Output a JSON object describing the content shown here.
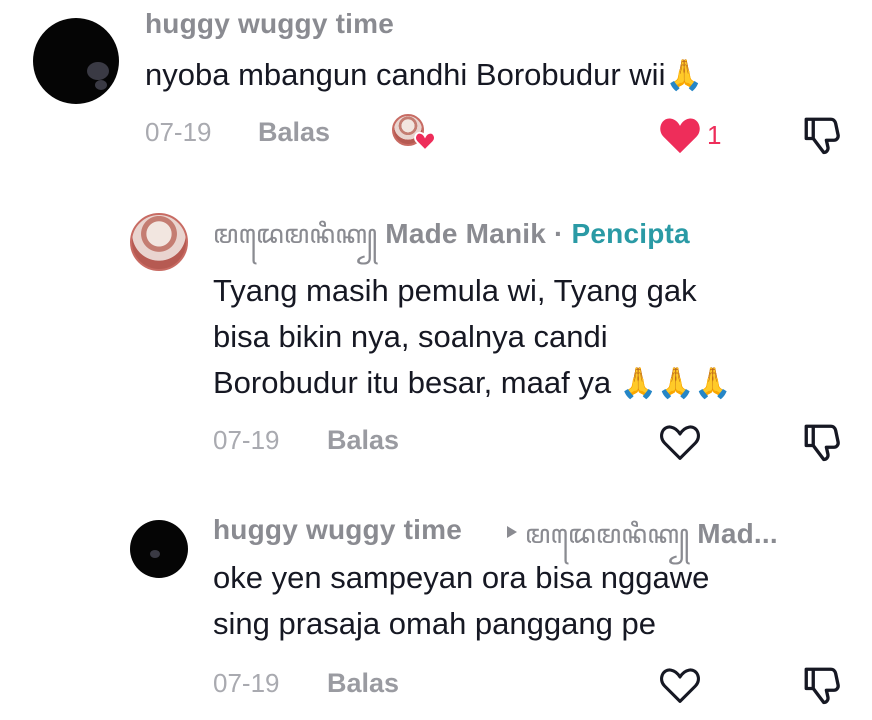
{
  "comments": [
    {
      "username": "huggy wuggy time",
      "text": "nyoba mbangun candhi Borobudur wii",
      "emoji": "🙏",
      "date": "07-19",
      "reply_label": "Balas",
      "like_count": "1"
    },
    {
      "username_script": "ꦩꦢꦺꦩꦤꦶꦏ꧀",
      "username": "Made Manik",
      "separator": "·",
      "badge": "Pencipta",
      "lines": [
        "Tyang masih pemula wi, Tyang gak",
        "bisa bikin nya, soalnya candi",
        "Borobudur itu besar, maaf ya"
      ],
      "emojis": "🙏🙏🙏",
      "date": "07-19",
      "reply_label": "Balas"
    },
    {
      "username": "huggy wuggy time",
      "reply_to_script": "ꦩꦢꦺꦩꦤꦶꦏ꧀",
      "reply_to_suffix": "Mad...",
      "lines": [
        "oke yen sampeyan ora bisa nggawe",
        "sing prasaja omah panggang pe"
      ],
      "date": "07-19",
      "reply_label": "Balas"
    }
  ],
  "colors": {
    "username": "#8a8b91",
    "creator_badge": "#2a9aa5",
    "like_red": "#ee2d5a",
    "meta": "#a9aab0"
  },
  "icons": [
    "heart-filled-icon",
    "heart-outline-icon",
    "dislike-icon",
    "reply-arrow-icon",
    "pray-emoji"
  ]
}
